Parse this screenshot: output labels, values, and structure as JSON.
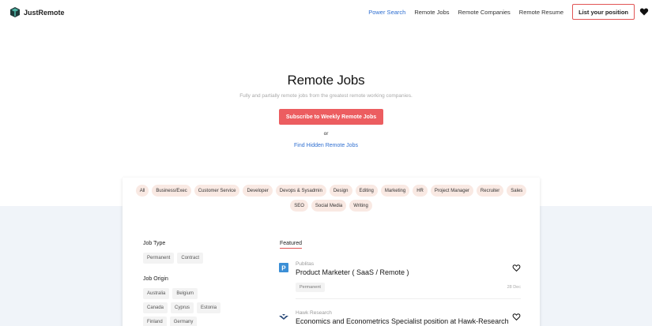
{
  "header": {
    "brand": "JustRemote",
    "nav": [
      "Power Search",
      "Remote Jobs",
      "Remote Companies",
      "Remote Resume"
    ],
    "cta": "List your position",
    "accent": "#2f6fd1",
    "brand_red": "#e15555"
  },
  "hero": {
    "title": "Remote Jobs",
    "subtitle": "Fully and partially remote jobs from the greatest remote working companies.",
    "subscribe": "Subscribe to Weekly Remote Jobs",
    "or": "or",
    "hidden": "Find Hidden Remote Jobs"
  },
  "categories": [
    "All",
    "Business/Exec",
    "Customer Service",
    "Developer",
    "Devops & Sysadmin",
    "Design",
    "Editing",
    "Marketing",
    "HR",
    "Project Manager",
    "Recruiter",
    "Sales",
    "SEO",
    "Social Media",
    "Writing"
  ],
  "filters": {
    "job_type_label": "Job Type",
    "job_types": [
      "Permanent",
      "Contract"
    ],
    "job_origin_label": "Job Origin",
    "origins": [
      [
        "Australia",
        "Belgium"
      ],
      [
        "Canada",
        "Cyprus",
        "Estonia"
      ],
      [
        "Finland",
        "Germany"
      ]
    ]
  },
  "featured_label": "Featured",
  "jobs": [
    {
      "company": "Publitas",
      "title": "Product Marketer ( SaaS / Remote )",
      "tag": "Permanent",
      "date": "28 Dec",
      "logo_icon": "publitas-p-icon"
    },
    {
      "company": "Hawk Research",
      "title": "Economics and Econometrics Specialist position at Hawk-Research",
      "logo_icon": "hawk-research-icon"
    }
  ]
}
